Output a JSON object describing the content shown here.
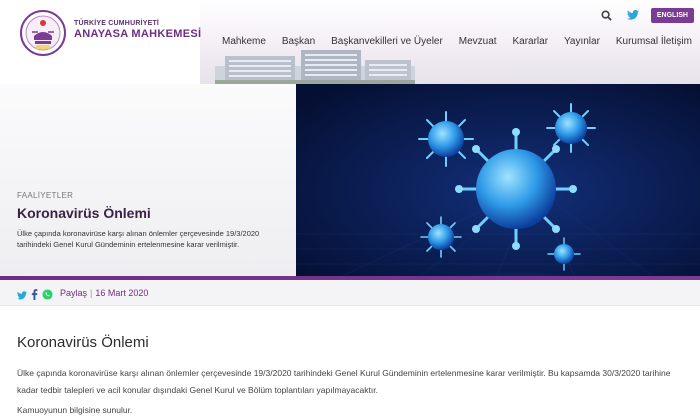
{
  "header": {
    "brand_top": "TÜRKİYE CUMHURİYETİ",
    "brand_main": "ANAYASA MAHKEMESİ",
    "language_button": "ENGLISH",
    "nav": [
      "Mahkeme",
      "Başkan",
      "Başkanvekilleri ve Üyeler",
      "Mevzuat",
      "Kararlar",
      "Yayınlar",
      "Kurumsal İletişim"
    ]
  },
  "hero": {
    "kicker": "FAALİYETLER",
    "title": "Koronavirüs Önlemi",
    "description": "Ülke çapında koronavirüse karşı alınan önlemler çerçevesinde 19/3/2020 tarihindeki Genel Kurul Gündeminin ertelenmesine karar verilmiştir."
  },
  "share": {
    "label": "Paylaş",
    "date": "16 Mart 2020"
  },
  "article": {
    "title": "Koronavirüs Önlemi",
    "paragraph1": "Ülke çapında koronavirüse karşı alınan önlemler çerçevesinde 19/3/2020 tarihindeki Genel Kurul Gündeminin ertelenmesine karar verilmiştir. Bu kapsamda 30/3/2020 tarihine kadar tedbir talepleri ve acil konular dışındaki Genel Kurul ve Bölüm toplantıları yapılmayacaktır.",
    "paragraph2": "Kamuoyunun bilgisine sunulur."
  },
  "colors": {
    "brand_purple": "#6f2c83",
    "hero_blue": "#081a4a",
    "virus_cyan": "#3fb6ff"
  },
  "icons": [
    "court-emblem-icon",
    "search-icon",
    "twitter-icon",
    "facebook-icon",
    "whatsapp-icon"
  ]
}
